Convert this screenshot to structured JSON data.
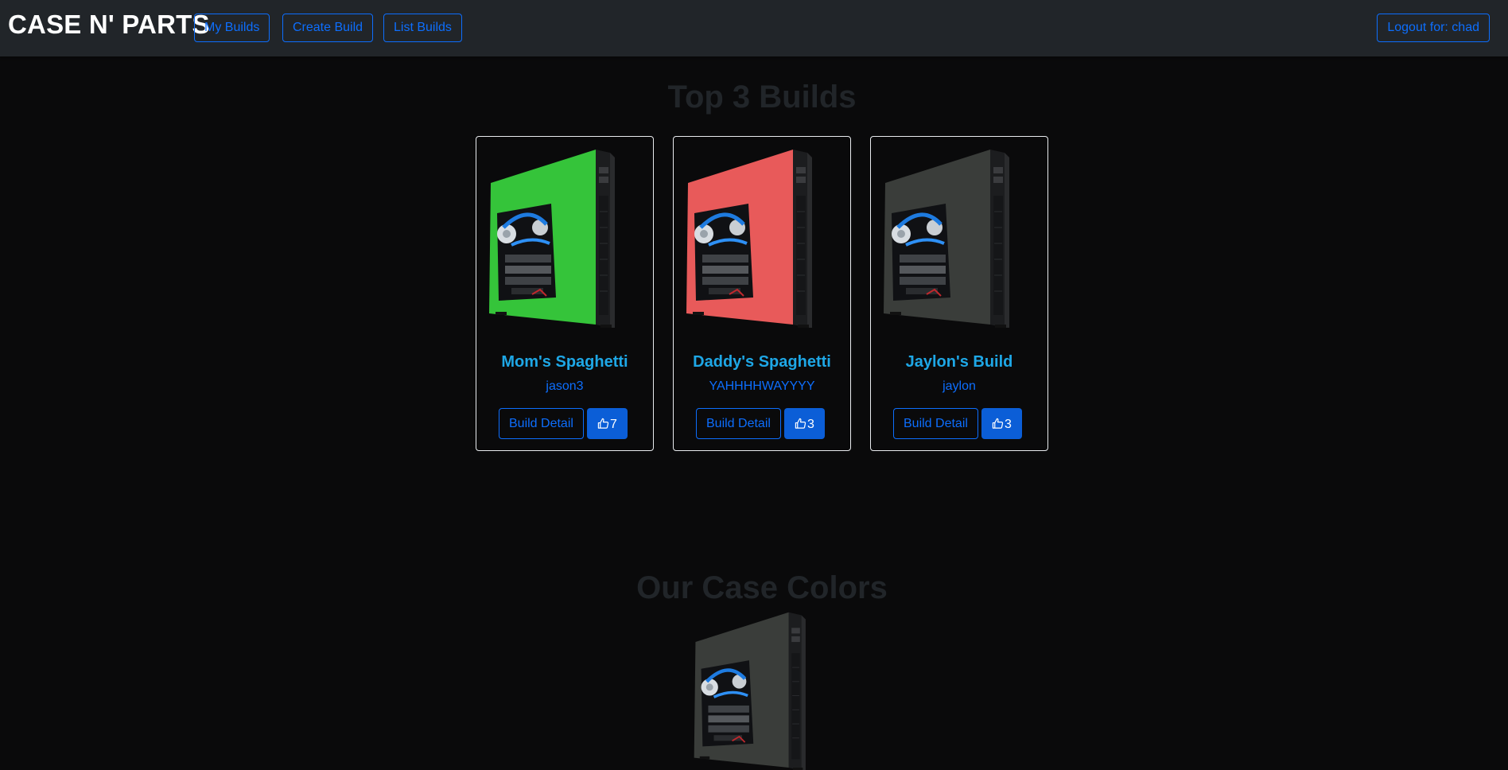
{
  "navbar": {
    "brand": "CASE N' PARTS",
    "links": [
      "My Builds",
      "Create Build",
      "List Builds"
    ],
    "logout_label": "Logout for: chad"
  },
  "top_builds": {
    "heading": "Top 3 Builds",
    "cards": [
      {
        "title": "Mom's Spaghetti",
        "author": "jason3",
        "detail_label": "Build Detail",
        "likes": "7",
        "case_color": "#35c43a"
      },
      {
        "title": "Daddy's Spaghetti",
        "author": "YAHHHHWAYYYY",
        "detail_label": "Build Detail",
        "likes": "3",
        "case_color": "#e85a5a"
      },
      {
        "title": "Jaylon's Build",
        "author": "jaylon",
        "detail_label": "Build Detail",
        "likes": "3",
        "case_color": "#3a3d3a"
      }
    ]
  },
  "case_colors": {
    "heading": "Our Case Colors",
    "current_color": "#3a3d3a"
  },
  "icons": {
    "like": "thumbs-up-icon"
  },
  "colors": {
    "accent": "#0d6efd",
    "title": "#1ea7e6",
    "navbar_bg": "#212529",
    "page_bg": "#0a0a0b"
  }
}
